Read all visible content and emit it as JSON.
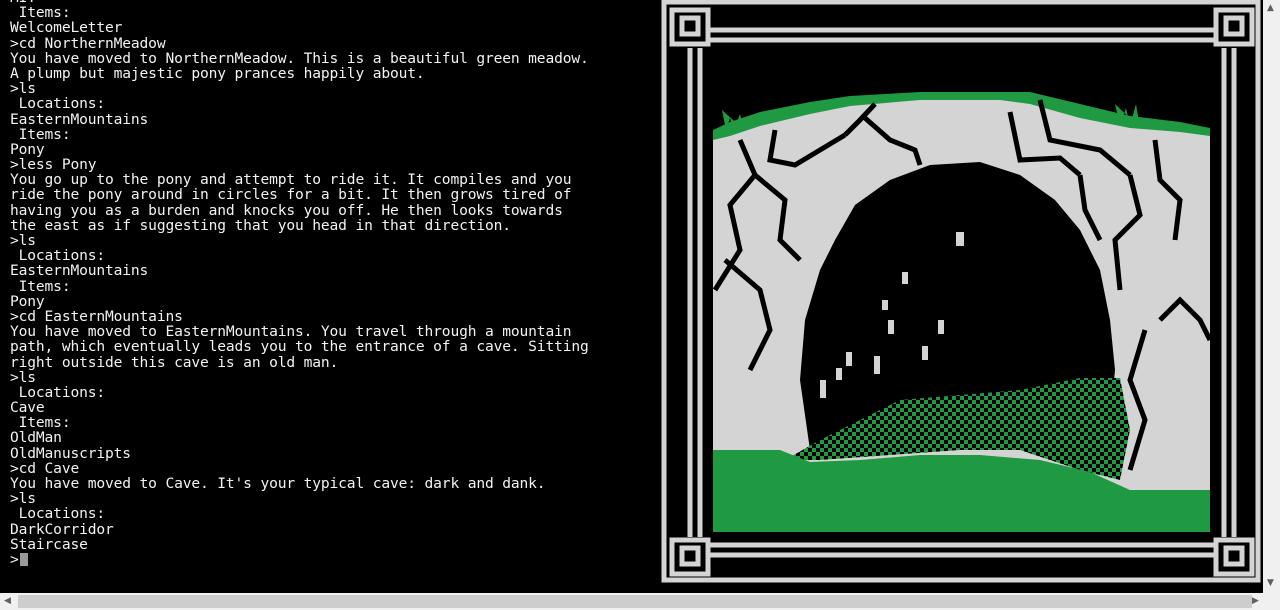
{
  "terminal": {
    "lines": [
      "MIT",
      " Items:",
      "WelcomeLetter",
      ">cd NorthernMeadow",
      "You have moved to NorthernMeadow. This is a beautiful green meadow.",
      "A plump but majestic pony prances happily about.",
      ">ls",
      " Locations:",
      "EasternMountains",
      " Items:",
      "Pony",
      ">less Pony",
      "You go up to the pony and attempt to ride it. It compiles and you",
      "ride the pony around in circles for a bit. It then grows tired of",
      "having you as a burden and knocks you off. He then looks towards",
      "the east as if suggesting that you head in that direction.",
      ">ls",
      " Locations:",
      "EasternMountains",
      " Items:",
      "Pony",
      ">cd EasternMountains",
      "You have moved to EasternMountains. You travel through a mountain",
      "path, which eventually leads you to the entrance of a cave. Sitting",
      "right outside this cave is an old man.",
      ">ls",
      " Locations:",
      "Cave",
      " Items:",
      "OldMan",
      "OldManuscripts",
      ">cd Cave",
      "You have moved to Cave. It's your typical cave: dark and dank.",
      ">ls",
      " Locations:",
      "DarkCorridor",
      "Staircase"
    ],
    "prompt": ">",
    "input_value": ""
  },
  "art": {
    "scene": "cave-entrance",
    "colors": {
      "frame": "#d4d4d4",
      "rock": "#d4d4d4",
      "cave_dark": "#000000",
      "grass": "#1f9a43"
    }
  },
  "scrollbars": {
    "up_arrow": "▲",
    "down_arrow": "▼",
    "left_arrow": "◀",
    "right_arrow": "▶"
  }
}
